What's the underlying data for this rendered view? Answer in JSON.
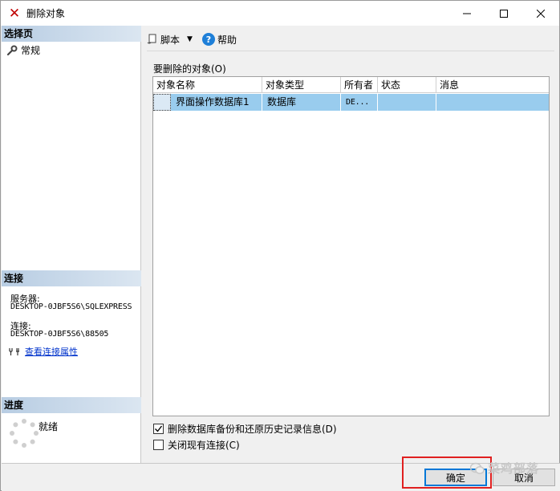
{
  "window": {
    "title": "删除对象"
  },
  "left": {
    "select_page_header": "选择页",
    "pages": [
      {
        "label": "常规",
        "icon": "wrench-icon"
      }
    ],
    "connection_header": "连接",
    "server_label": "服务器:",
    "server_value": "DESKTOP-0JBF5S6\\SQLEXPRESS",
    "connection_label": "连接:",
    "connection_value": "DESKTOP-0JBF5S6\\88505",
    "view_props_link": "查看连接属性",
    "progress_header": "进度",
    "progress_status": "就绪"
  },
  "toolbar": {
    "script_label": "脚本",
    "help_label": "帮助"
  },
  "objects": {
    "label": "要删除的对象(O)",
    "columns": [
      "对象名称",
      "对象类型",
      "所有者",
      "状态",
      "消息"
    ],
    "rows": [
      {
        "name": "界面操作数据库1",
        "type": "数据库",
        "owner": "DE...",
        "status": "",
        "message": ""
      }
    ]
  },
  "options": {
    "delete_backup_history": {
      "label": "删除数据库备份和还原历史记录信息(D)",
      "checked": true
    },
    "close_connections": {
      "label": "关闭现有连接(C)",
      "checked": false
    }
  },
  "buttons": {
    "ok": "确定",
    "cancel": "取消"
  },
  "watermark": {
    "text": "菜鸡部落"
  },
  "colors": {
    "selection": "#99ccee",
    "header_gradient_start": "#b8cde3",
    "link": "#0033cc",
    "highlight": "#e02020"
  }
}
